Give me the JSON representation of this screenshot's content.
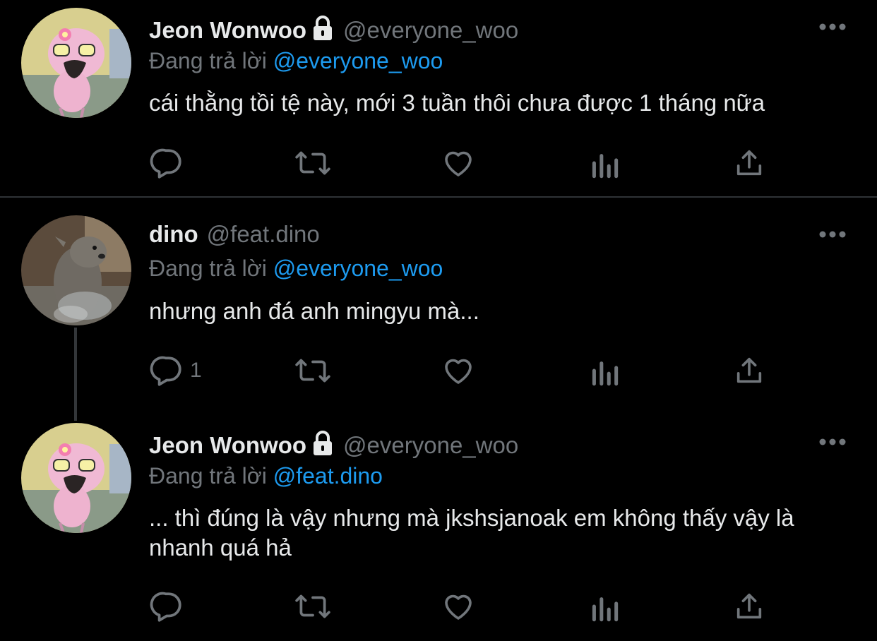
{
  "colors": {
    "background": "#000000",
    "text": "#e7e9ea",
    "muted": "#71767b",
    "link": "#1d9bf0",
    "divider": "#2f3336"
  },
  "tweets": [
    {
      "display_name": "Jeon Wonwoo",
      "locked": true,
      "handle": "@everyone_woo",
      "reply_prefix": "Đang trả lời",
      "reply_to": "@everyone_woo",
      "text": "cái thằng tồi tệ này, mới 3 tuần thôi chưa được 1 tháng nữa",
      "avatar": "pink-sheep-character-icon",
      "reply_count": ""
    },
    {
      "display_name": "dino",
      "locked": false,
      "handle": "@feat.dino",
      "reply_prefix": "Đang trả lời",
      "reply_to": "@everyone_woo",
      "text": "nhưng anh đá anh mingyu mà...",
      "avatar": "otter-photo-icon",
      "reply_count": "1"
    },
    {
      "display_name": "Jeon Wonwoo",
      "locked": true,
      "handle": "@everyone_woo",
      "reply_prefix": "Đang trả lời",
      "reply_to": "@feat.dino",
      "text": "... thì đúng là vậy nhưng mà jkshsjanoak em không thấy vậy là nhanh quá hả",
      "avatar": "pink-sheep-character-icon",
      "reply_count": ""
    }
  ],
  "icons": {
    "reply": "reply-icon",
    "retweet": "retweet-icon",
    "like": "heart-icon",
    "views": "analytics-icon",
    "share": "share-icon",
    "more": "more-icon",
    "lock": "lock-icon"
  }
}
